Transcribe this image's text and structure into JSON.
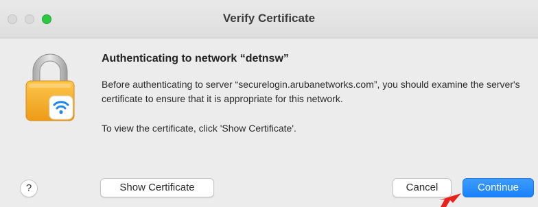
{
  "window": {
    "title": "Verify Certificate"
  },
  "dialog": {
    "heading": "Authenticating to network “detnsw”",
    "body": "Before authenticating to server “securelogin.arubanetworks.com”, you should examine the server's certificate to ensure that it is appropriate for this network.",
    "hint": "To view the certificate, click 'Show Certificate'.",
    "icon": "lock-wifi-icon"
  },
  "buttons": {
    "help": "?",
    "show_certificate": "Show Certificate",
    "cancel": "Cancel",
    "continue": "Continue"
  },
  "colors": {
    "accent": "#1a82fb",
    "zoom_button": "#2bc840",
    "annotation_arrow": "#e8231c",
    "lock_body": "#f5a623"
  }
}
